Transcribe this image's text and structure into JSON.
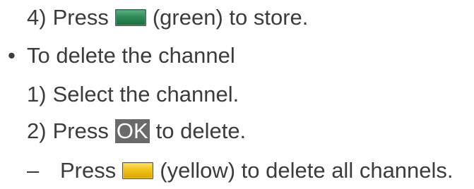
{
  "lines": {
    "store": {
      "number": "4)",
      "before": "Press",
      "key_icon": "green-button-icon",
      "key_color": "#2e8b57",
      "after": "(green) to store."
    },
    "delete_heading": {
      "bullet": "•",
      "text": "To delete the channel"
    },
    "select": {
      "number": "1)",
      "text": "Select the channel."
    },
    "delete": {
      "number": "2)",
      "before": "Press",
      "ok_label": "OK",
      "after": "to delete."
    },
    "delete_all": {
      "dash": "–",
      "before": "Press",
      "key_icon": "yellow-button-icon",
      "key_color": "#f0c21a",
      "after": "(yellow) to delete all channels."
    }
  }
}
